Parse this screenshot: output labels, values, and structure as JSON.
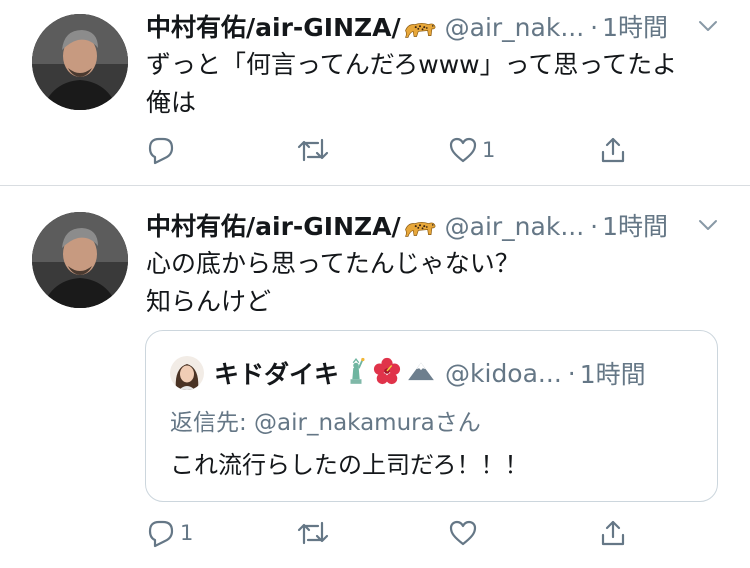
{
  "colors": {
    "text": "#14171a",
    "secondary": "#657786",
    "divider": "#d9dde1",
    "quote_border": "#ccd6dd"
  },
  "tweets": [
    {
      "name": "中村有佑/air-GINZA/",
      "name_emoji": "leopard-emoji",
      "handle": "@air_nak...",
      "dot": "·",
      "time": "1時間",
      "lines": [
        "ずっと「何言ってんだろwww」って思ってたよ",
        "俺は"
      ],
      "reply_count": "",
      "retweet_count": "",
      "like_count": "1"
    },
    {
      "name": "中村有佑/air-GINZA/",
      "name_emoji": "leopard-emoji",
      "handle": "@air_nak...",
      "dot": "·",
      "time": "1時間",
      "lines": [
        "心の底から思ってたんじゃない？",
        "知らんけど"
      ],
      "quote": {
        "name": "キドダイキ",
        "emojis": [
          "statue-of-liberty-emoji",
          "hibiscus-emoji",
          "mountain-emoji"
        ],
        "handle": "@kidoa...",
        "dot": "·",
        "time": "1時間",
        "reply_to": "返信先: @air_nakamuraさん",
        "text": "これ流行らしたの上司だろ！！！"
      },
      "reply_count": "1",
      "retweet_count": "",
      "like_count": ""
    }
  ]
}
